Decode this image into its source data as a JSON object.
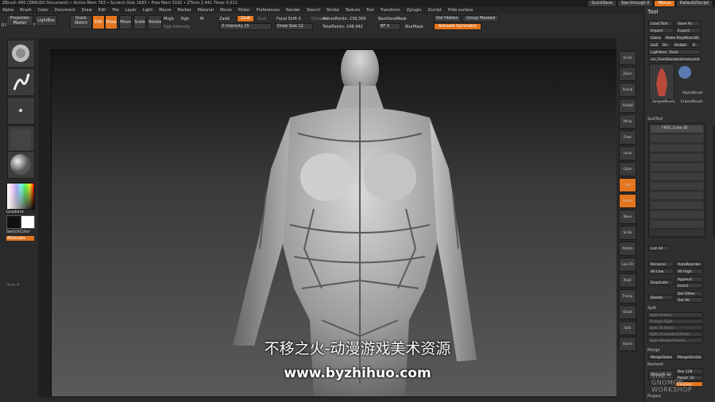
{
  "window": {
    "title": "ZBrush 4R6 (ZBRUSH Document) • Active Mem 783 • Scratch Disk 1683 • Free Mem 3192 • ZTime 2.441 Timer 0.011",
    "quicksave": "QuickSave",
    "see_through": "See-through 0",
    "menus_label": "Menus",
    "default_zscript": "DefaultZScript"
  },
  "menubar": [
    "Alpha",
    "Brush",
    "Color",
    "Document",
    "Draw",
    "Edit",
    "File",
    "Layer",
    "Light",
    "Macro",
    "Marker",
    "Material",
    "Movie",
    "Picker",
    "Preferences",
    "Render",
    "Stencil",
    "Stroke",
    "Texture",
    "Tool",
    "Transform",
    "Zplugin",
    "Zscript",
    "Hide surface"
  ],
  "coords": "0.855,0.615,0.655",
  "toolbar": {
    "projection_master": "Projection Master",
    "lightbox": "LightBox",
    "quick_sketch": "Quick Sketch",
    "edit": "Edit",
    "draw": "Draw",
    "move": "Move",
    "scale": "Scale",
    "rotate": "Rotate",
    "mrgb": "Mrgb",
    "rgb": "Rgb",
    "m": "M",
    "zadd": "Zadd",
    "zsub": "Zsub",
    "zcut": "Zcut",
    "rgb_intensity": "Rgb Intensity",
    "z_intensity": "Z Intensity 25",
    "focal_shift": "Focal Shift 0",
    "draw_size": "Draw Size 12",
    "dynamic": "Dynamic",
    "active_points": "ActivePoints: 239,369",
    "total_points": "TotalPoints: 248,442",
    "backface_mask": "BackfaceMask",
    "bf_value": "BF 0",
    "blur_mask": "BlurMask",
    "del_hidden": "Del Hidden",
    "group_masked": "Group Masked",
    "activate_symmetry": "Activate Symmetry"
  },
  "left_shelf": {
    "gradient": "Gradient",
    "switch_color": "SwitchColor",
    "alternate": "Alternate",
    "item_label": "Item 4"
  },
  "right_shelf": [
    "Scroll",
    "Zoom",
    "Actual",
    "AAHalf",
    "Persp",
    "Floor",
    "Local",
    "LSym",
    "Xyz",
    "Frame",
    "Move",
    "Scale",
    "Rotate",
    "Line Fill",
    "PolyF",
    "Transp",
    "Ghost",
    "Solo",
    "Xpose"
  ],
  "tool_panel": {
    "header": "Tool",
    "load_tool": "Load Tool",
    "save_as": "Save As",
    "import": "Import",
    "export": "Export",
    "clone": "Clone",
    "make_polymesh": "Make PolyMesh3D",
    "goz": "GoZ",
    "all": "All",
    "visible": "Visible",
    "r": "R",
    "lightbox_tools": "Lightbox› Tools",
    "current_tool": "uci_FreeStandard(reduced)",
    "simple_brush": "SimpleBrush",
    "alpha_brush": "AlphaBrush",
    "eraser_brush": "EraserBrush",
    "subtool": "SubTool",
    "subtool_item": "FREE_Cube_ID",
    "list_all": "List All",
    "rename": "Rename",
    "autoreorder": "AutoReorder",
    "all_low": "All Low",
    "all_high": "All High",
    "duplicate": "Duplicate",
    "append": "Append",
    "insert": "Insert",
    "delete": "Delete",
    "del_other": "Del Other",
    "del_all": "Del All",
    "split": "Split",
    "split_items": [
      "Split Hidden",
      "Groups Split",
      "Split To Parts",
      "Split Unmasked Points",
      "Split Masked Points"
    ],
    "merge": "Merge",
    "merge_down": "MergeDown",
    "merge_similar": "MergeSimilar",
    "remesh": "Remesh",
    "remesh_all": "Remesh All",
    "res": "Res 128",
    "polish": "Polish 10",
    "polygroups": "PolyGrp",
    "project": "Project"
  },
  "overlay": {
    "caption_cn": "不移之火-动漫游戏美术资源",
    "caption_url": "www.byzhihuo.com"
  },
  "watermark": {
    "line1": "THE",
    "line2": "GNOMON",
    "line3": "WORKSHOP"
  }
}
